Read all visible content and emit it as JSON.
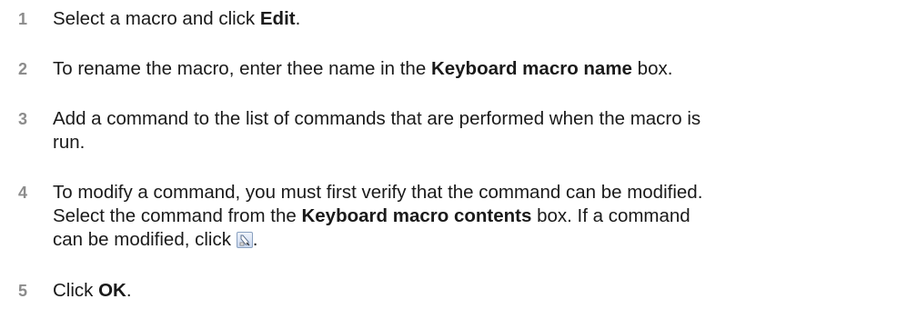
{
  "steps": [
    {
      "number": "1",
      "parts": [
        "Select a macro and click ",
        "Edit",
        "."
      ]
    },
    {
      "number": "2",
      "parts": [
        "To rename the macro, enter thee name in the ",
        "Keyboard macro name",
        " box."
      ]
    },
    {
      "number": "3",
      "line1": "Add a command to the list of commands that are performed when the macro is",
      "line2": "run."
    },
    {
      "number": "4",
      "line1": "To modify a command, you must first verify that the command can be modified.",
      "line2_parts": [
        "Select the command from the ",
        "Keyboard macro contents",
        " box. If a command"
      ],
      "line3_parts": [
        "can be modified, click ",
        "."
      ],
      "icon": "edit-command-icon"
    },
    {
      "number": "5",
      "parts": [
        "Click ",
        "OK",
        "."
      ]
    }
  ]
}
